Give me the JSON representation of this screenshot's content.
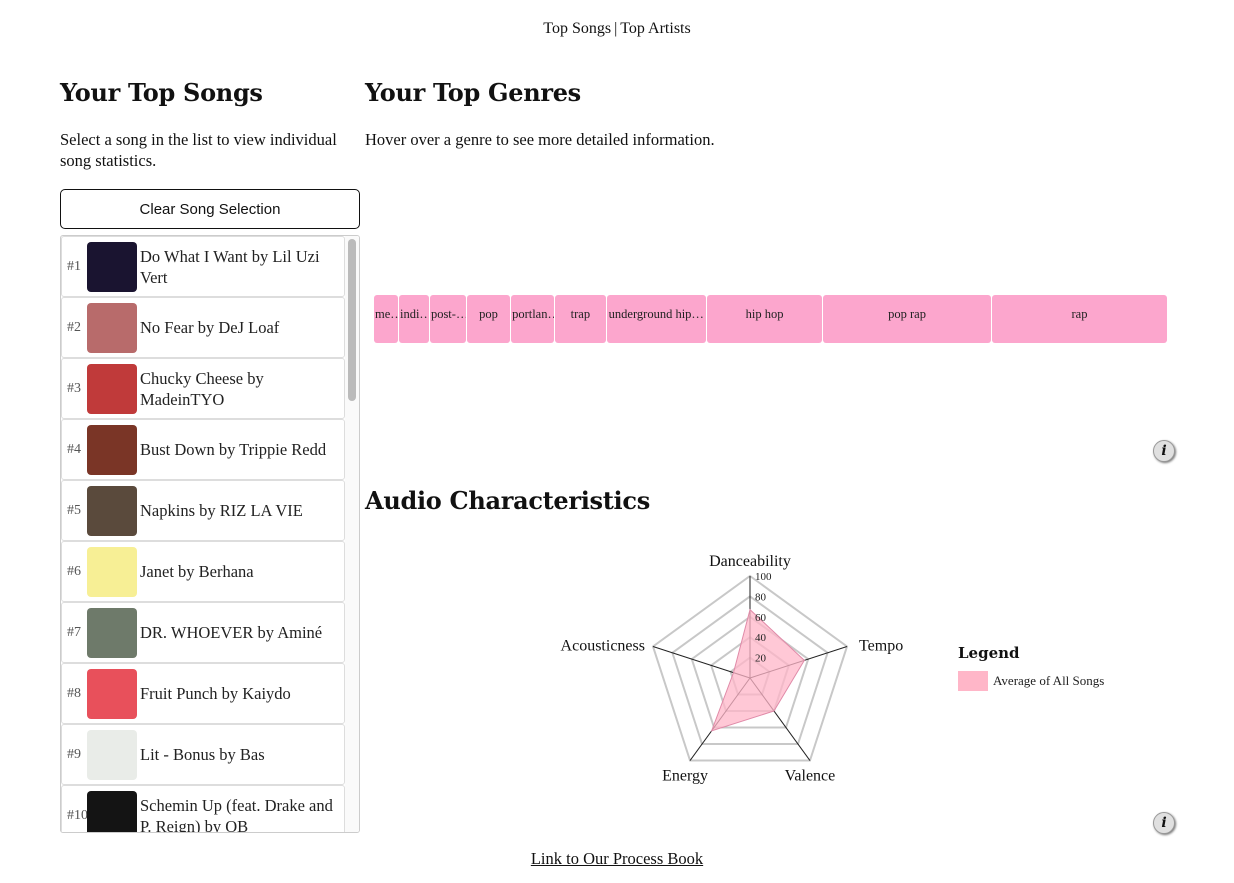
{
  "nav": {
    "songs_label": "Top Songs",
    "separator": "|",
    "artists_label": "Top Artists"
  },
  "songs_panel": {
    "title": "Your Top Songs",
    "description": "Select a song in the list to view individual song statistics.",
    "clear_button": "Clear Song Selection",
    "items": [
      {
        "rank": "#1",
        "name": "Do What I Want by Lil Uzi Vert",
        "art_color": "#1a1430"
      },
      {
        "rank": "#2",
        "name": "No Fear by DeJ Loaf",
        "art_color": "#b86b6b"
      },
      {
        "rank": "#3",
        "name": "Chucky Cheese by MadeinTYO",
        "art_color": "#c03a3a"
      },
      {
        "rank": "#4",
        "name": "Bust Down by Trippie Redd",
        "art_color": "#7a3526"
      },
      {
        "rank": "#5",
        "name": "Napkins by RIZ LA VIE",
        "art_color": "#5a4a3c"
      },
      {
        "rank": "#6",
        "name": "Janet by Berhana",
        "art_color": "#f7ef95"
      },
      {
        "rank": "#7",
        "name": "DR. WHOEVER by Aminé",
        "art_color": "#6e7a6a"
      },
      {
        "rank": "#8",
        "name": "Fruit Punch by Kaiydo",
        "art_color": "#e8505b"
      },
      {
        "rank": "#9",
        "name": "Lit - Bonus by Bas",
        "art_color": "#e9ece8"
      },
      {
        "rank": "#10",
        "name": "Schemin Up (feat. Drake and P. Reign) by OB",
        "art_color": "#141414"
      }
    ]
  },
  "genres_panel": {
    "title": "Your Top Genres",
    "description": "Hover over a genre to see more detailed information.",
    "info_icon": "i",
    "bar_color": "#fca6cd",
    "genres": [
      {
        "label": "me…",
        "weight": 2
      },
      {
        "label": "indi…",
        "weight": 2.5
      },
      {
        "label": "post-…",
        "weight": 3
      },
      {
        "label": "pop",
        "weight": 3.6
      },
      {
        "label": "portlan…",
        "weight": 3.6
      },
      {
        "label": "trap",
        "weight": 4.2
      },
      {
        "label": "underground hip…",
        "weight": 8.3
      },
      {
        "label": "hip hop",
        "weight": 9.6
      },
      {
        "label": "pop rap",
        "weight": 14
      },
      {
        "label": "rap",
        "weight": 14.6
      }
    ]
  },
  "audio_panel": {
    "title": "Audio Characteristics",
    "info_icon": "i",
    "axes": [
      "Danceability",
      "Tempo",
      "Valence",
      "Energy",
      "Acousticness"
    ],
    "ticks": [
      "100",
      "80",
      "60",
      "40",
      "20"
    ],
    "max": 100,
    "average_values": [
      67,
      56,
      40,
      64,
      17
    ],
    "fill_color": "#ffb6c8",
    "legend": {
      "title": "Legend",
      "label": "Average of All Songs"
    }
  },
  "footer": {
    "link_text": "Link to Our Process Book"
  }
}
